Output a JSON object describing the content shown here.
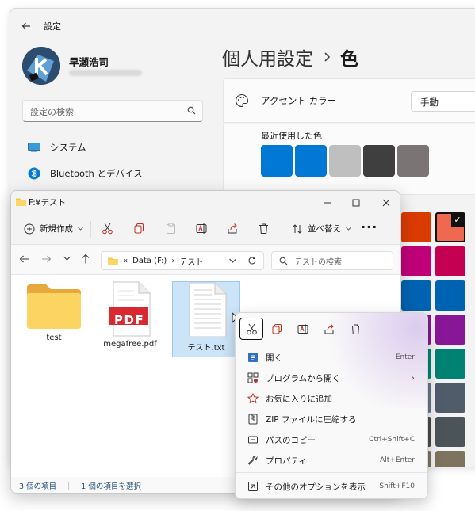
{
  "settings": {
    "title": "設定",
    "user_name": "早瀬浩司",
    "search_placeholder": "設定の検索",
    "nav": [
      {
        "label": "システム",
        "icon": "monitor-icon"
      },
      {
        "label": "Bluetooth とデバイス",
        "icon": "bluetooth-icon"
      }
    ],
    "breadcrumb": [
      "個人用設定",
      "色"
    ],
    "accent_label": "アクセント カラー",
    "accent_mode": "手動",
    "recent_label": "最近使用した色",
    "recent_colors": [
      "#0078d4",
      "#0078d4",
      "#bfbfbf",
      "#3f3f3f",
      "#7a7574"
    ],
    "grid_colors": [
      [
        "#c43e1c",
        "#da3b01",
        "#ef6950"
      ],
      [
        "#e3008c",
        "#bf0077",
        "#c30052"
      ],
      [
        "#0078d4",
        "#0063b1",
        "#0063b1"
      ],
      [
        "#8764b8",
        "#881798",
        "#881798"
      ],
      [
        "#00b294",
        "#018574",
        "#008272"
      ],
      [
        "#525e54",
        "#68768a",
        "#515c6b"
      ],
      [
        "#567c73",
        "#4c4a48",
        "#4a5459"
      ],
      [
        "#7e735f",
        "#7e735f",
        "#7e735f"
      ]
    ],
    "selected_color_check": "✓"
  },
  "explorer": {
    "title": "F:¥テスト",
    "new_label": "新規作成",
    "sort_label": "並べ替え",
    "path": [
      "«",
      "Data (F:)",
      "›",
      "テスト"
    ],
    "search_placeholder": "テストの検索",
    "files": [
      {
        "name": "test",
        "type": "folder"
      },
      {
        "name": "megafree.pdf",
        "type": "pdf",
        "badge": "PDF"
      },
      {
        "name": "テスト.txt",
        "type": "text"
      }
    ],
    "status_count": "3 個の項目",
    "status_selected": "1 個の項目を選択"
  },
  "context_menu": {
    "quick_actions": [
      "cut-icon",
      "copy-icon",
      "rename-icon",
      "share-icon",
      "delete-icon"
    ],
    "items": [
      {
        "label": "開く",
        "key": "Enter",
        "icon": "open-icon"
      },
      {
        "label": "プログラムから開く",
        "key": "›",
        "icon": "open-with-icon"
      },
      {
        "label": "お気に入りに追加",
        "key": "",
        "icon": "star-icon"
      },
      {
        "label": "ZIP ファイルに圧縮する",
        "key": "",
        "icon": "zip-icon"
      },
      {
        "label": "パスのコピー",
        "key": "Ctrl+Shift+C",
        "icon": "copy-path-icon"
      },
      {
        "label": "プロパティ",
        "key": "Alt+Enter",
        "icon": "properties-icon"
      }
    ],
    "more_options": {
      "label": "その他のオプションを表示",
      "key": "Shift+F10",
      "icon": "more-options-icon"
    }
  },
  "colors": {
    "accent": "#0078d4",
    "selection": "#cce4f7",
    "pdf_red": "#d9282f",
    "folder": "#f7c948"
  }
}
